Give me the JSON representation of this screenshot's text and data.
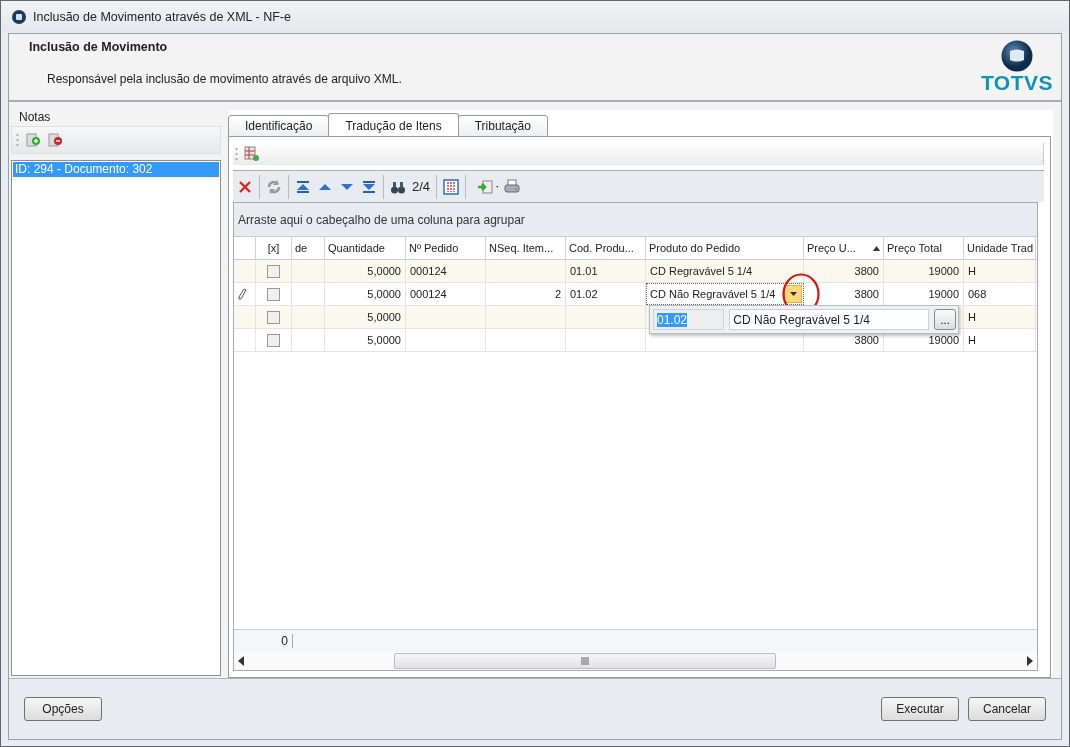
{
  "window": {
    "title": "Inclusão de Movimento através de XML - NF-e"
  },
  "header": {
    "title": "Inclusão de Movimento",
    "description": "Responsável pela inclusão de movimento através de arquivo XML.",
    "logo": "TOTVS"
  },
  "notes_panel": {
    "title": "Notas",
    "items": [
      {
        "label": "ID: 294 - Documento: 302",
        "selected": true
      }
    ]
  },
  "tabs": [
    {
      "label": "Identificação",
      "selected": false
    },
    {
      "label": "Tradução de Itens",
      "selected": true
    },
    {
      "label": "Tributação",
      "selected": false
    }
  ],
  "toolbar": {
    "record_position": "2/4"
  },
  "grid": {
    "group_hint": "Arraste aqui o cabeçalho de uma coluna para agrupar",
    "checkbox_column": "[x]",
    "columns": [
      {
        "label": "de"
      },
      {
        "label": "Quantidade"
      },
      {
        "label": "Nº Pedido"
      },
      {
        "label": "NSeq. Item..."
      },
      {
        "label": "Cod. Produ..."
      },
      {
        "label": "Produto do Pedido"
      },
      {
        "label": "Preço U...",
        "sorted": true
      },
      {
        "label": "Preço Total"
      },
      {
        "label": "Unidade Trad"
      }
    ],
    "rows": [
      {
        "editing": false,
        "checked": false,
        "cells": [
          null,
          "5,0000",
          "000124",
          null,
          "01.01",
          "CD Regravável 5 1/4",
          "3800",
          "19000",
          "H"
        ]
      },
      {
        "editing": true,
        "checked": false,
        "cells": [
          null,
          "5,0000",
          "000124",
          "2",
          "01.02",
          "CD Não Regravável 5 1/4",
          "3800",
          "19000",
          "068"
        ]
      },
      {
        "editing": false,
        "checked": false,
        "cells": [
          null,
          "5,0000",
          null,
          null,
          null,
          null,
          null,
          null,
          "H"
        ]
      },
      {
        "editing": false,
        "checked": false,
        "cells": [
          null,
          "5,0000",
          null,
          null,
          null,
          null,
          "3800",
          "19000",
          "H"
        ]
      }
    ],
    "footer_count": "0"
  },
  "editor_popup": {
    "code": "01.02",
    "description": "CD Não Regravável 5 1/4",
    "button": "..."
  },
  "buttons": {
    "options": "Opções",
    "execute": "Executar",
    "cancel": "Cancelar"
  }
}
